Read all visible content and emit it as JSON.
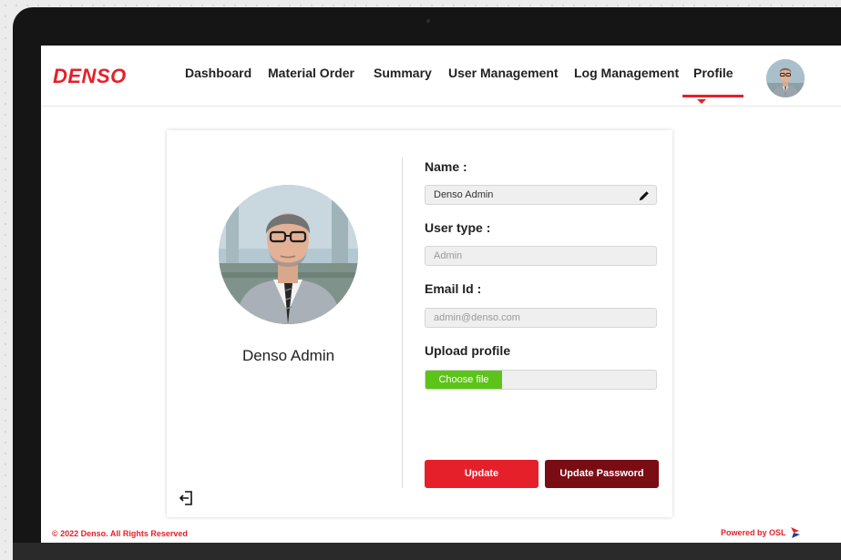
{
  "app": {
    "logo": "DENSO"
  },
  "nav": {
    "items": [
      {
        "label": "Dashboard"
      },
      {
        "label": "Material Order"
      },
      {
        "label": "Summary"
      },
      {
        "label": "User Management"
      },
      {
        "label": "Log Management"
      },
      {
        "label": "Profile",
        "active": true
      }
    ]
  },
  "profile": {
    "display_name": "Denso Admin",
    "name_label": "Name :",
    "name_value": "Denso Admin",
    "user_type_label": "User type :",
    "user_type_value": "Admin",
    "email_label": "Email Id :",
    "email_value": "admin@denso.com",
    "upload_label": "Upload profile",
    "choose_file_label": "Choose file",
    "update_label": "Update",
    "update_password_label": "Update Password"
  },
  "footer": {
    "copyright": "© 2022 Denso. All Rights Reserved",
    "powered_by": "Powered by OSL"
  },
  "icons": {
    "edit": "pencil-icon",
    "logout": "logout-icon",
    "brand_mark": "osl-logo-icon"
  },
  "colors": {
    "brand_red": "#e5202a",
    "dark_red": "#7a0d14",
    "green": "#5cc419"
  }
}
